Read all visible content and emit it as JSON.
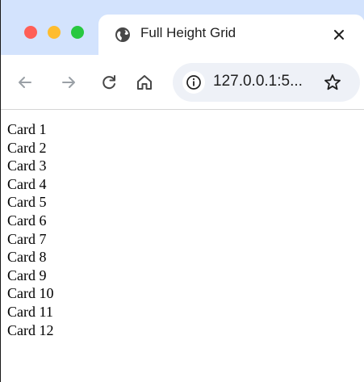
{
  "browser": {
    "tab": {
      "title": "Full Height Grid",
      "favicon": "globe-icon"
    },
    "toolbar": {
      "url": "127.0.0.1:5...",
      "icons": [
        "back-arrow-icon",
        "forward-arrow-icon",
        "reload-icon",
        "home-icon",
        "info-icon",
        "star-icon"
      ]
    },
    "colors": {
      "tabstrip": "#d3e3fd",
      "close_light": "#ff5f57",
      "minimize_light": "#febc2e",
      "maximize_light": "#28c840",
      "omnibox": "#eef1f7"
    }
  },
  "page": {
    "cards": [
      "Card 1",
      "Card 2",
      "Card 3",
      "Card 4",
      "Card 5",
      "Card 6",
      "Card 7",
      "Card 8",
      "Card 9",
      "Card 10",
      "Card 11",
      "Card 12"
    ]
  }
}
